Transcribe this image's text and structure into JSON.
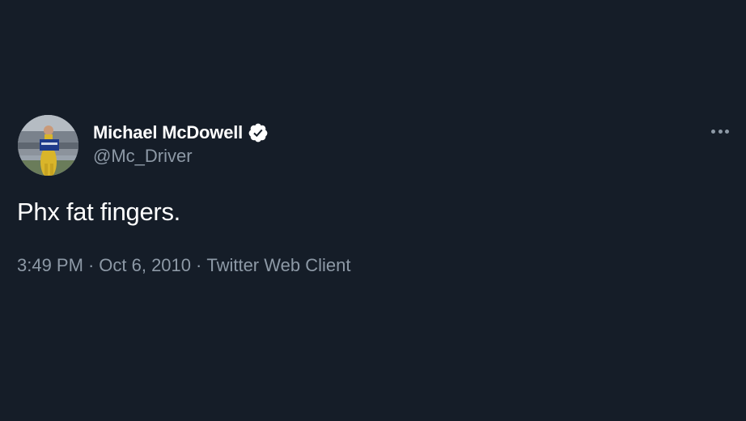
{
  "tweet": {
    "author": {
      "display_name": "Michael McDowell",
      "handle": "@Mc_Driver",
      "verified": true,
      "avatar_icon": "profile-photo"
    },
    "text": "Phx fat fingers.",
    "time": "3:49 PM",
    "date": "Oct 6, 2010",
    "separator": "·",
    "source": "Twitter Web Client",
    "more_icon": "more-horizontal-icon"
  },
  "colors": {
    "background": "#151d28",
    "text_primary": "#ffffff",
    "text_secondary": "#8d99a6",
    "verified_badge": "#ffffff"
  }
}
